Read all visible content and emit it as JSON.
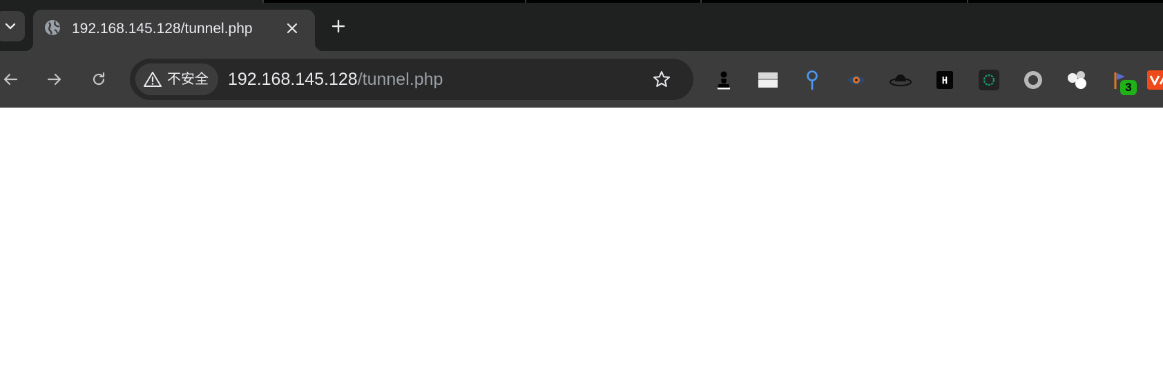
{
  "tab": {
    "title": "192.168.145.128/tunnel.php",
    "favicon": "globe-icon",
    "close_icon": "close-icon"
  },
  "tabstrip": {
    "search_tabs_icon": "chevron-down-icon",
    "new_tab_icon": "plus-icon"
  },
  "toolbar": {
    "back_icon": "arrow-left-icon",
    "forward_icon": "arrow-right-icon",
    "reload_icon": "reload-icon",
    "bookmark_icon": "star-icon"
  },
  "omnibox": {
    "security_icon": "warning-icon",
    "security_label": "不安全",
    "url_host": "192.168.145.128",
    "url_path": "/tunnel.php"
  },
  "extensions": [
    {
      "name": "chess-pawn-icon"
    },
    {
      "name": "grey-bars-icon"
    },
    {
      "name": "blue-pin-icon"
    },
    {
      "name": "eye-icon"
    },
    {
      "name": "fedora-hat-icon"
    },
    {
      "name": "h-block-icon"
    },
    {
      "name": "green-ring-icon"
    },
    {
      "name": "grey-circle-icon"
    },
    {
      "name": "bubbles-icon"
    },
    {
      "name": "orange-flag-icon",
      "badge": "3"
    },
    {
      "name": "red-logo-icon"
    }
  ],
  "colors": {
    "tabstrip_bg": "#1f2020",
    "toolbar_bg": "#3c3c3c",
    "omnibox_bg": "#282828",
    "text": "#e8eaed",
    "badge_green": "#1fb01a",
    "page_bg": "#ffffff"
  }
}
